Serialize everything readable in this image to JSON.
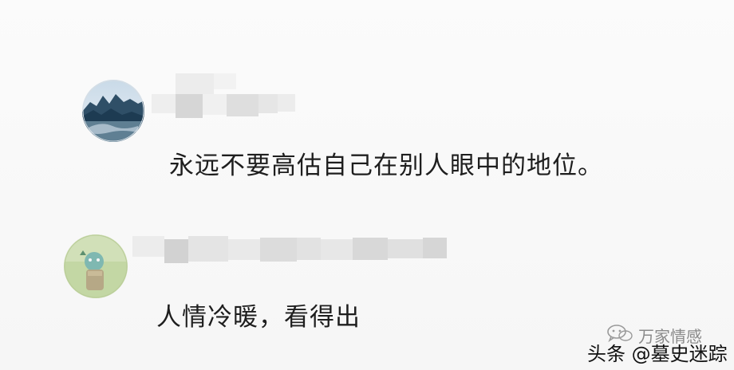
{
  "comments": [
    {
      "text": "永远不要高估自己在别人眼中的地位。",
      "avatar_icon": "landscape-avatar-icon"
    },
    {
      "text": "人情冷暖，看得出",
      "avatar_icon": "cartoon-avatar-icon"
    }
  ],
  "watermark": {
    "brand": "万家情感",
    "brand_icon": "wechat-icon",
    "source": "头条 @墓史迷踪"
  }
}
